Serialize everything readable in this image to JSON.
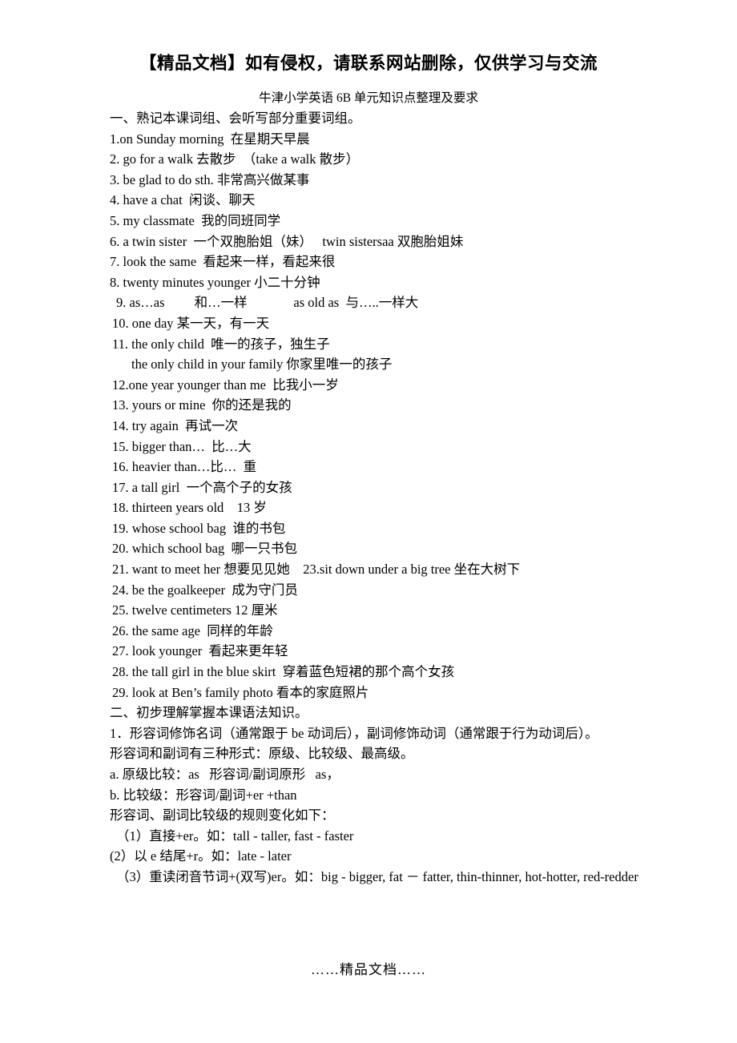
{
  "header": {
    "watermark": "【精品文档】如有侵权，请联系网站删除，仅供学习与交流"
  },
  "title": "牛津小学英语 6B 单元知识点整理及要求",
  "sections": {
    "one_heading": "一、熟记本课词组、会听写部分重要词组。",
    "phrases": [
      "1.on Sunday morning  在星期天早晨",
      "2. go for a walk 去散步  （take a walk 散步）",
      "3. be glad to do sth. 非常高兴做某事",
      "4. have a chat  闲谈、聊天",
      "5. my classmate  我的同班同学",
      "6. a twin sister  一个双胞胎姐（妹）   twin sistersaa 双胞胎姐妹",
      "7. look the same  看起来一样，看起来很",
      "8. twenty minutes younger 小二十分钟",
      "9. as…as         和…一样              as old as  与…..一样大",
      "10. one day 某一天，有一天",
      "11. the only child  唯一的孩子，独生子",
      "the only child in your family 你家里唯一的孩子",
      "12.one year younger than me  比我小一岁",
      "13. yours or mine  你的还是我的",
      "14. try again  再试一次",
      "15. bigger than…  比…大",
      "16. heavier than…比…  重",
      "17. a tall girl  一个高个子的女孩",
      "18. thirteen years old    13 岁",
      "19. whose school bag  谁的书包",
      "20. which school bag  哪一只书包",
      "21. want to meet her 想要见见她    23.sit down under a big tree 坐在大树下",
      "24. be the goalkeeper  成为守门员",
      "25. twelve centimeters 12 厘米",
      "26. the same age  同样的年龄",
      "27. look younger  看起来更年轻",
      "28. the tall girl in the blue skirt  穿着蓝色短裙的那个高个女孩",
      "29. look at Ben’s family photo 看本的家庭照片"
    ],
    "two_heading": "二、初步理解掌握本课语法知识。",
    "grammar": [
      "1．形容词修饰名词（通常跟于 be 动词后），副词修饰动词（通常跟于行为动词后）。",
      "形容词和副词有三种形式：原级、比较级、最高级。",
      "a. 原级比较：as   形容词/副词原形   as，",
      "b. 比较级：形容词/副词+er +than",
      "形容词、副词比较级的规则变化如下：",
      "（1）直接+er。如：tall - taller, fast - faster",
      "(2）以 e 结尾+r。如：late - later",
      "（3）重读闭音节词+(双写)er。如：big - bigger, fat － fatter, thin-thinner, hot-hotter, red-redder"
    ]
  },
  "footer": "……精品文档……"
}
